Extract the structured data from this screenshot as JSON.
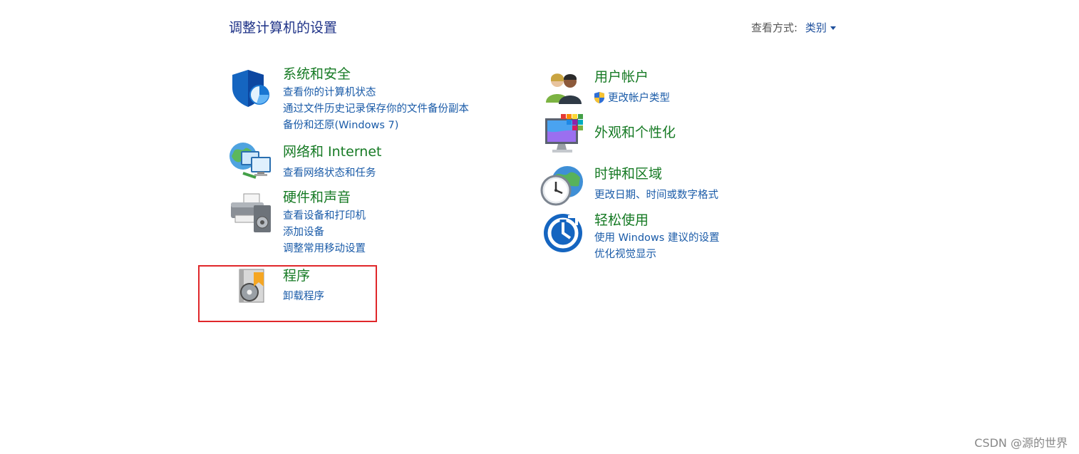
{
  "header": {
    "title": "调整计算机的设置",
    "view_by_label": "查看方式:",
    "view_by_value": "类别"
  },
  "categories": {
    "system_security": {
      "title": "系统和安全",
      "links": [
        "查看你的计算机状态",
        "通过文件历史记录保存你的文件备份副本",
        "备份和还原(Windows 7)"
      ]
    },
    "network": {
      "title": "网络和 Internet",
      "links": [
        "查看网络状态和任务"
      ]
    },
    "hardware": {
      "title": "硬件和声音",
      "links": [
        "查看设备和打印机",
        "添加设备",
        "调整常用移动设置"
      ]
    },
    "programs": {
      "title": "程序",
      "links": [
        "卸载程序"
      ]
    },
    "user_accounts": {
      "title": "用户帐户",
      "links": [
        "更改帐户类型"
      ]
    },
    "appearance": {
      "title": "外观和个性化",
      "links": []
    },
    "clock_region": {
      "title": "时钟和区域",
      "links": [
        "更改日期、时间或数字格式"
      ]
    },
    "ease_of_access": {
      "title": "轻松使用",
      "links": [
        "使用 Windows 建议的设置",
        "优化视觉显示"
      ]
    }
  },
  "watermark": "CSDN @源的世界",
  "colors": {
    "title": "#1e3287",
    "category": "#167a24",
    "link": "#1a5ba8",
    "highlight": "#e0272a"
  }
}
